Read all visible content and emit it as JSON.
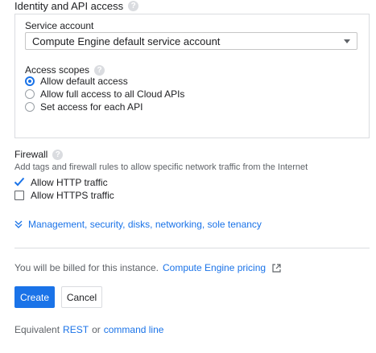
{
  "identity": {
    "title": "Identity and API access",
    "service_account_label": "Service account",
    "service_account_value": "Compute Engine default service account",
    "access_scopes_label": "Access scopes",
    "access_scopes": [
      {
        "label": "Allow default access",
        "selected": true
      },
      {
        "label": "Allow full access to all Cloud APIs",
        "selected": false
      },
      {
        "label": "Set access for each API",
        "selected": false
      }
    ]
  },
  "firewall": {
    "title": "Firewall",
    "description": "Add tags and firewall rules to allow specific network traffic from the Internet",
    "options": [
      {
        "label": "Allow HTTP traffic",
        "checked": true
      },
      {
        "label": "Allow HTTPS traffic",
        "checked": false
      }
    ]
  },
  "expand_link": "Management, security, disks, networking, sole tenancy",
  "billing": {
    "text": "You will be billed for this instance.",
    "pricing_link": "Compute Engine pricing"
  },
  "buttons": {
    "create": "Create",
    "cancel": "Cancel"
  },
  "footer": {
    "prefix": "Equivalent",
    "rest_link": "REST",
    "or": "or",
    "cli_link": "command line"
  },
  "help_icon_glyph": "?",
  "colors": {
    "accent": "#1a73e8",
    "text": "#202124",
    "muted": "#5f6368",
    "border": "#dadce0"
  }
}
